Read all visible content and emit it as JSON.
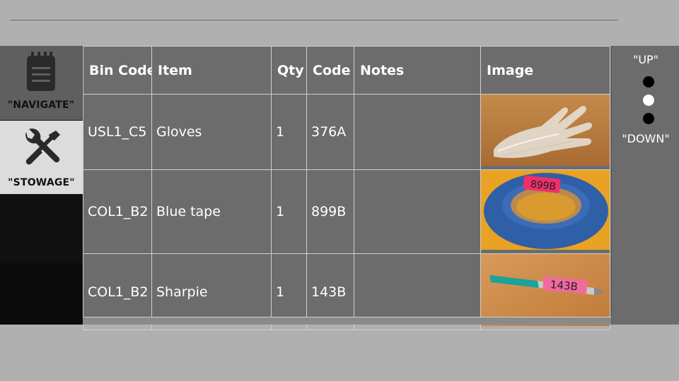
{
  "nav": {
    "navigate_label": "\"NAVIGATE\"",
    "stowage_label": "\"STOWAGE\""
  },
  "table": {
    "headers": [
      "Bin Code",
      "Item",
      "Qty",
      "Code",
      "Notes",
      "Image"
    ],
    "rows": [
      {
        "bin_code": "USL1_C5",
        "item": "Gloves",
        "qty": "1",
        "code": "376A",
        "notes": "",
        "image": "gloves-photo"
      },
      {
        "bin_code": "COL1_B2",
        "item": "Blue tape",
        "qty": "1",
        "code": "899B",
        "notes": "",
        "image": "blue-tape-photo"
      },
      {
        "bin_code": "COL1_B2",
        "item": "Sharpie",
        "qty": "1",
        "code": "143B",
        "notes": "",
        "image": "sharpie-photo"
      }
    ]
  },
  "image_labels": {
    "tape_tag": "899B",
    "sharpie_tag": "143B"
  },
  "scroll": {
    "up_label": "\"UP\"",
    "down_label": "\"DOWN\"",
    "position_index": 2,
    "total_positions": 3
  },
  "colors": {
    "background": "#b0b0b0",
    "panel": "#6c6c6c",
    "sidebar_active": "#dcdcdc",
    "sidebar_inactive": "#5f5f5f"
  }
}
